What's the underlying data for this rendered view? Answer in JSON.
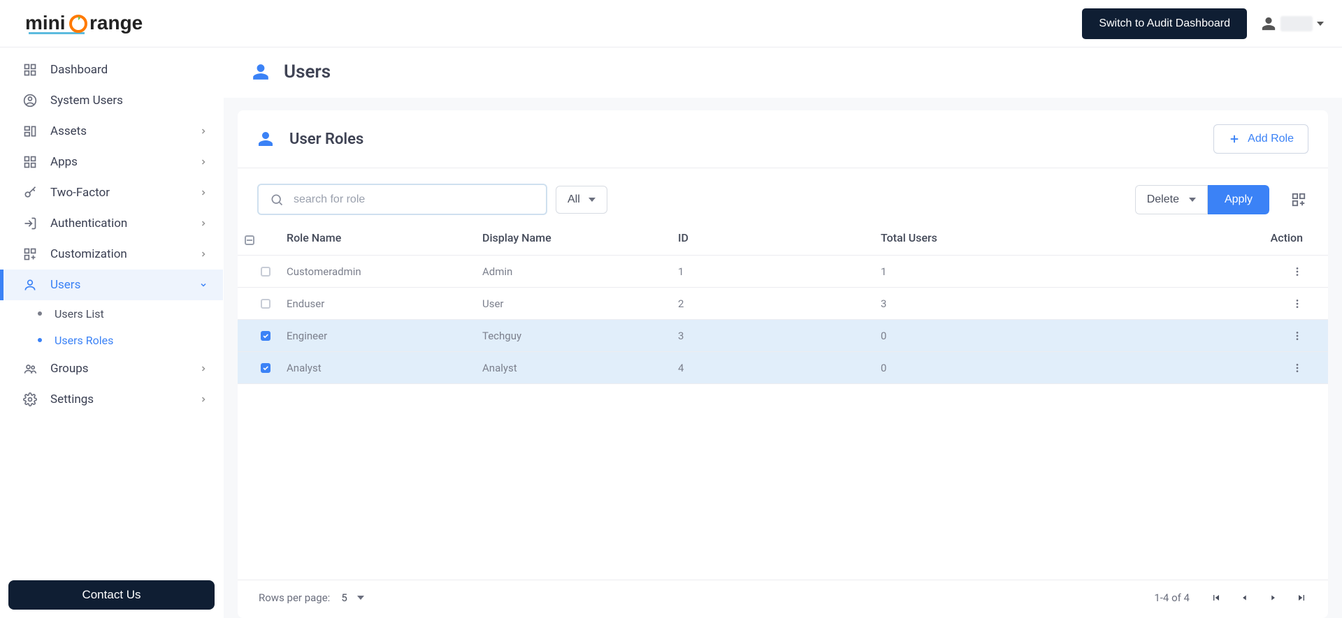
{
  "brand": {
    "name": "miniorange"
  },
  "header": {
    "switch_dashboard": "Switch to Audit Dashboard"
  },
  "sidebar": {
    "items": [
      {
        "label": "Dashboard",
        "icon": "grid",
        "expandable": false
      },
      {
        "label": "System Users",
        "icon": "user-circle",
        "expandable": false
      },
      {
        "label": "Assets",
        "icon": "assets",
        "expandable": true
      },
      {
        "label": "Apps",
        "icon": "grid",
        "expandable": true
      },
      {
        "label": "Two-Factor",
        "icon": "key",
        "expandable": true
      },
      {
        "label": "Authentication",
        "icon": "login",
        "expandable": true
      },
      {
        "label": "Customization",
        "icon": "grid-plus",
        "expandable": true
      },
      {
        "label": "Users",
        "icon": "person",
        "expandable": true,
        "active": true
      },
      {
        "label": "Groups",
        "icon": "group",
        "expandable": true
      },
      {
        "label": "Settings",
        "icon": "gear",
        "expandable": true
      }
    ],
    "users_sub": [
      {
        "label": "Users List",
        "active": false
      },
      {
        "label": "Users Roles",
        "active": true
      }
    ],
    "contact": "Contact Us"
  },
  "page": {
    "title": "Users",
    "card_title": "User Roles",
    "add_role": "Add Role",
    "search_placeholder": "search for role",
    "filter_label": "All",
    "action_select": "Delete",
    "apply": "Apply"
  },
  "table": {
    "columns": {
      "role_name": "Role Name",
      "display_name": "Display Name",
      "id": "ID",
      "total_users": "Total Users",
      "action": "Action"
    },
    "rows": [
      {
        "selected": false,
        "role_name": "Customeradmin",
        "display_name": "Admin",
        "id": "1",
        "total_users": "1"
      },
      {
        "selected": false,
        "role_name": "Enduser",
        "display_name": "User",
        "id": "2",
        "total_users": "3"
      },
      {
        "selected": true,
        "role_name": "Engineer",
        "display_name": "Techguy",
        "id": "3",
        "total_users": "0"
      },
      {
        "selected": true,
        "role_name": "Analyst",
        "display_name": "Analyst",
        "id": "4",
        "total_users": "0"
      }
    ]
  },
  "pagination": {
    "rows_per_page_label": "Rows per page:",
    "rows_per_page_value": "5",
    "range": "1-4 of 4"
  }
}
